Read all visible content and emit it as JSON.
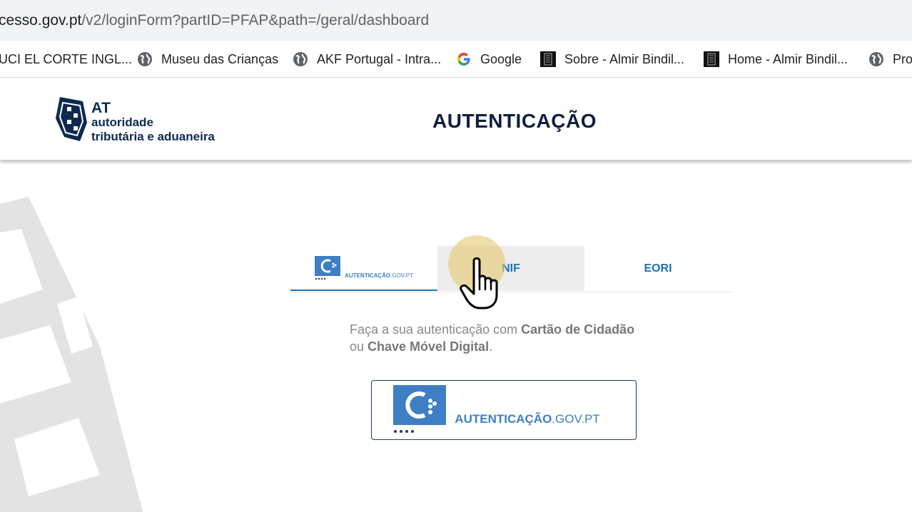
{
  "browser": {
    "url_host": "cesso.gov.pt",
    "url_path": "/v2/loginForm?partID=PFAP&path=/geral/dashboard",
    "bookmarks": [
      {
        "label": "UCI EL CORTE INGL...",
        "icon": "none"
      },
      {
        "label": "Museu das Crianças",
        "icon": "globe-icon"
      },
      {
        "label": "AKF Portugal - Intra...",
        "icon": "globe-icon"
      },
      {
        "label": "Google",
        "icon": "google-icon"
      },
      {
        "label": "Sobre - Almir Bindil...",
        "icon": "dark-square-icon"
      },
      {
        "label": "Home - Almir Bindil...",
        "icon": "dark-square-icon"
      },
      {
        "label": "Pro",
        "icon": "globe-icon"
      }
    ]
  },
  "header": {
    "logo": {
      "at": "AT",
      "line1": "autoridade",
      "line2": "tributária e aduaneira"
    },
    "title": "AUTENTICAÇÃO"
  },
  "tabs": {
    "items": [
      {
        "label": "AUTENTICAÇÃO.GOV.PT",
        "logo_main": "AUTENTICAÇÃO",
        "logo_suffix": ".GOV.PT",
        "active": true
      },
      {
        "label": "NIF",
        "active": false
      },
      {
        "label": "EORI",
        "active": false
      }
    ]
  },
  "main": {
    "desc_prefix": "Faça a sua autenticação com ",
    "desc_bold1": "Cartão de Cidadão",
    "desc_mid": "ou ",
    "desc_bold2": "Chave Móvel Digital",
    "desc_end": ".",
    "auth_button": {
      "logo_main": "AUTENTICAÇÃO",
      "logo_suffix": ".GOV.PT"
    }
  },
  "colors": {
    "accent": "#1a73b5",
    "brand_navy": "#0d2a4e",
    "autenticacao_blue": "#3e7fc4"
  }
}
